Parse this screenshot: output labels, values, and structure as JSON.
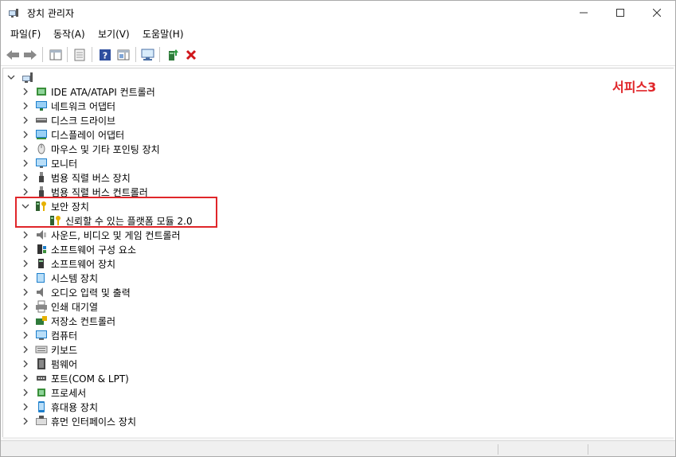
{
  "window": {
    "title": "장치 관리자"
  },
  "menu": {
    "file": "파일(F)",
    "action": "동작(A)",
    "view": "보기(V)",
    "help": "도움말(H)"
  },
  "tree": {
    "root_label": "",
    "items": [
      {
        "label": "IDE ATA/ATAPI 컨트롤러",
        "icon": "ide-controller-icon",
        "expanded": false
      },
      {
        "label": "네트워크 어댑터",
        "icon": "network-adapter-icon",
        "expanded": false
      },
      {
        "label": "디스크 드라이브",
        "icon": "disk-drive-icon",
        "expanded": false
      },
      {
        "label": "디스플레이 어댑터",
        "icon": "display-adapter-icon",
        "expanded": false
      },
      {
        "label": "마우스 및 기타 포인팅 장치",
        "icon": "mouse-icon",
        "expanded": false
      },
      {
        "label": "모니터",
        "icon": "monitor-icon",
        "expanded": false
      },
      {
        "label": "범용 직렬 버스 장치",
        "icon": "usb-icon",
        "expanded": false
      },
      {
        "label": "범용 직렬 버스 컨트롤러",
        "icon": "usb-icon",
        "expanded": false
      },
      {
        "label": "보안 장치",
        "icon": "security-device-icon",
        "expanded": true
      },
      {
        "label": "사운드, 비디오 및 게임 컨트롤러",
        "icon": "sound-icon",
        "expanded": false
      },
      {
        "label": "소프트웨어 구성 요소",
        "icon": "software-component-icon",
        "expanded": false
      },
      {
        "label": "소프트웨어 장치",
        "icon": "software-device-icon",
        "expanded": false
      },
      {
        "label": "시스템 장치",
        "icon": "system-device-icon",
        "expanded": false
      },
      {
        "label": "오디오 입력 및 출력",
        "icon": "audio-icon",
        "expanded": false
      },
      {
        "label": "인쇄 대기열",
        "icon": "printer-icon",
        "expanded": false
      },
      {
        "label": "저장소 컨트롤러",
        "icon": "storage-controller-icon",
        "expanded": false
      },
      {
        "label": "컴퓨터",
        "icon": "computer-icon",
        "expanded": false
      },
      {
        "label": "키보드",
        "icon": "keyboard-icon",
        "expanded": false
      },
      {
        "label": "펌웨어",
        "icon": "firmware-icon",
        "expanded": false
      },
      {
        "label": "포트(COM & LPT)",
        "icon": "port-icon",
        "expanded": false
      },
      {
        "label": "프로세서",
        "icon": "processor-icon",
        "expanded": false
      },
      {
        "label": "휴대용 장치",
        "icon": "portable-device-icon",
        "expanded": false
      },
      {
        "label": "휴먼 인터페이스 장치",
        "icon": "hid-icon",
        "expanded": false
      }
    ],
    "child": {
      "label": "신뢰할 수 있는 플랫폼 모듈 2.0",
      "icon": "tpm-icon"
    }
  },
  "annotation": {
    "text": "서피스3",
    "color": "#e0262a"
  }
}
